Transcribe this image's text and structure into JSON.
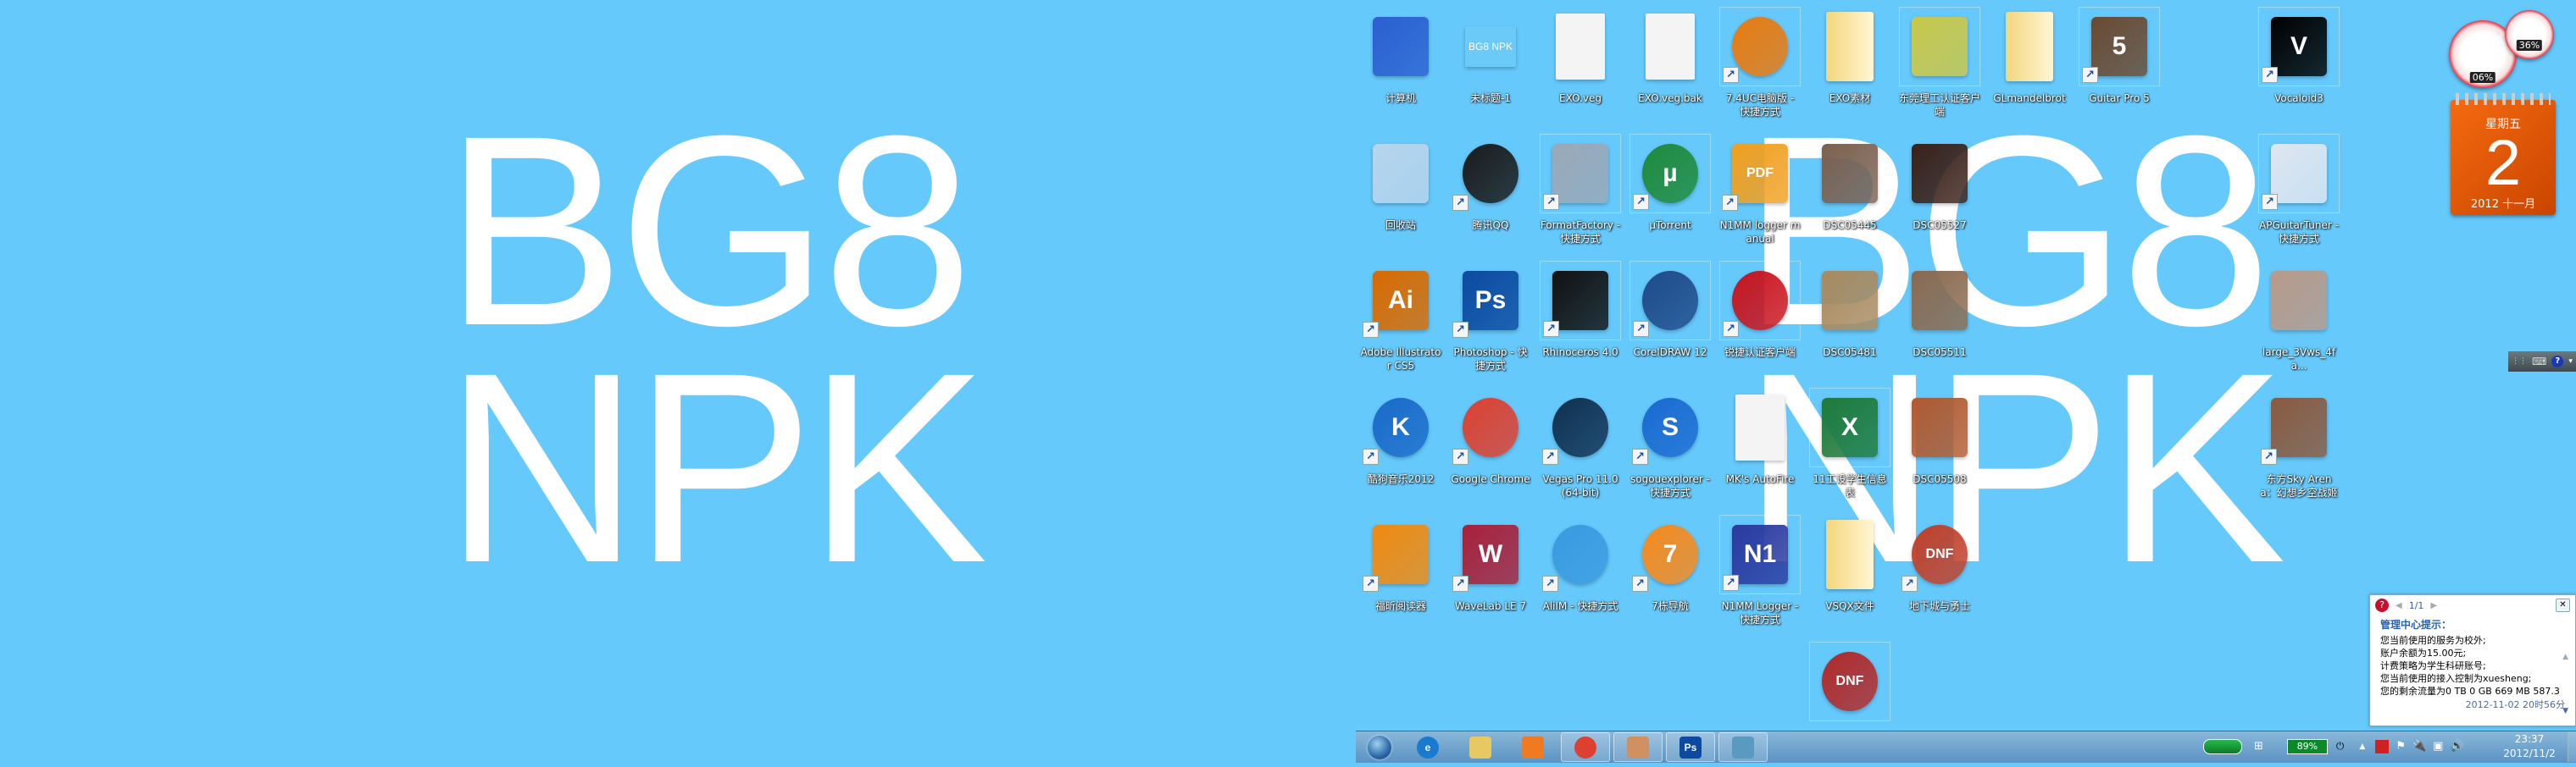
{
  "wallpaper": {
    "line1": "BG8",
    "line2": "NPK",
    "background": "#65c9fc"
  },
  "desktop_icons": [
    {
      "label": "计算机",
      "row": 0,
      "col": 0,
      "icon": "computer-icon",
      "color": "#2a5fd0",
      "shape": "square"
    },
    {
      "label": "未标题-1",
      "row": 0,
      "col": 1,
      "icon": "image-thumbnail-icon",
      "color": "#6ccaf7",
      "glyph": "BG8 NPK",
      "shape": "thumb"
    },
    {
      "label": "EXO.veg",
      "row": 0,
      "col": 2,
      "icon": "blank-file-icon",
      "color": "#f4f4f4",
      "shape": "doc"
    },
    {
      "label": "EXO.veg.bak",
      "row": 0,
      "col": 3,
      "icon": "blank-file-icon",
      "color": "#f4f4f4",
      "shape": "doc"
    },
    {
      "label": "7.4UC电脑版 - 快捷方式",
      "row": 0,
      "col": 4,
      "icon": "uc-browser-icon",
      "color": "#e87a10",
      "shape": "round",
      "shortcut": true,
      "framed": true
    },
    {
      "label": "EXO素材",
      "row": 0,
      "col": 5,
      "icon": "folder-icon",
      "color": "#f3d67c",
      "shape": "folder"
    },
    {
      "label": "东莞理工认证客户端",
      "row": 0,
      "col": 6,
      "icon": "installer-icon",
      "color": "#c8c84a",
      "shape": "square",
      "framed": true
    },
    {
      "label": "GLmandelbrot",
      "row": 0,
      "col": 7,
      "icon": "folder-icon",
      "color": "#f3d67c",
      "shape": "folder"
    },
    {
      "label": "Guitar Pro 5",
      "row": 0,
      "col": 8,
      "icon": "guitar-pro-icon",
      "color": "#6a4a32",
      "glyph": "5",
      "shape": "square",
      "shortcut": true,
      "framed": true
    },
    {
      "label": "Vocaloid3",
      "row": 0,
      "col": 10,
      "icon": "vocaloid-icon",
      "color": "#000000",
      "glyph": "V",
      "shape": "square",
      "shortcut": true,
      "framed": true
    },
    {
      "label": "回收站",
      "row": 1,
      "col": 0,
      "icon": "recycle-bin-icon",
      "color": "#b8d4ec",
      "shape": "square"
    },
    {
      "label": "腾讯QQ",
      "row": 1,
      "col": 1,
      "icon": "qq-penguin-icon",
      "color": "#1a1a1a",
      "shape": "round",
      "shortcut": true
    },
    {
      "label": "FormatFactory - 快捷方式",
      "row": 1,
      "col": 2,
      "icon": "format-factory-icon",
      "color": "#9aa8b8",
      "shape": "square",
      "shortcut": true,
      "framed": true
    },
    {
      "label": "µTorrent",
      "row": 1,
      "col": 3,
      "icon": "utorrent-icon",
      "color": "#1e8a3a",
      "glyph": "µ",
      "shape": "round",
      "shortcut": true,
      "framed": true
    },
    {
      "label": "N1MM logger manual",
      "row": 1,
      "col": 4,
      "icon": "pdf-file-icon",
      "color": "#f0a020",
      "glyph": "PDF",
      "shape": "square",
      "shortcut": true
    },
    {
      "label": "DSC05445",
      "row": 1,
      "col": 5,
      "icon": "photo-thumbnail-icon",
      "color": "#7a6050",
      "shape": "square"
    },
    {
      "label": "DSC05527",
      "row": 1,
      "col": 6,
      "icon": "photo-thumbnail-icon",
      "color": "#3a2018",
      "shape": "square"
    },
    {
      "label": "APGuitarTuner - 快捷方式",
      "row": 1,
      "col": 10,
      "icon": "guitar-tuner-icon",
      "color": "#dfe6f0",
      "shape": "square",
      "shortcut": true,
      "framed": true
    },
    {
      "label": "Adobe Illustrator CS5",
      "row": 2,
      "col": 0,
      "icon": "illustrator-icon",
      "color": "#d86a00",
      "glyph": "Ai",
      "shape": "square",
      "shortcut": true
    },
    {
      "label": "Photoshop - 快捷方式",
      "row": 2,
      "col": 1,
      "icon": "photoshop-icon",
      "color": "#0b4aa0",
      "glyph": "Ps",
      "shape": "square",
      "shortcut": true
    },
    {
      "label": "Rhinoceros 4.0",
      "row": 2,
      "col": 2,
      "icon": "rhinoceros-icon",
      "color": "#111111",
      "shape": "square",
      "shortcut": true,
      "framed": true
    },
    {
      "label": "CorelDRAW 12",
      "row": 2,
      "col": 3,
      "icon": "coreldraw-icon",
      "color": "#1f4a8a",
      "shape": "round",
      "shortcut": true,
      "framed": true
    },
    {
      "label": "锐捷认证客户端",
      "row": 2,
      "col": 4,
      "icon": "ruijie-client-icon",
      "color": "#c8141e",
      "shape": "round",
      "shortcut": true,
      "framed": true
    },
    {
      "label": "DSC05481",
      "row": 2,
      "col": 5,
      "icon": "photo-thumbnail-icon",
      "color": "#a88a60",
      "shape": "square"
    },
    {
      "label": "DSC05511",
      "row": 2,
      "col": 6,
      "icon": "photo-thumbnail-icon",
      "color": "#8a6a50",
      "shape": "square"
    },
    {
      "label": "large_3Vws_4fa...",
      "row": 2,
      "col": 10,
      "icon": "photo-thumbnail-icon",
      "color": "#b89a8a",
      "shape": "square"
    },
    {
      "label": "酷狗音乐2012",
      "row": 3,
      "col": 0,
      "icon": "kugou-icon",
      "color": "#1a6ac8",
      "glyph": "K",
      "shape": "round",
      "shortcut": true
    },
    {
      "label": "Google Chrome",
      "row": 3,
      "col": 1,
      "icon": "chrome-icon",
      "color": "#dd4030",
      "shape": "round",
      "shortcut": true
    },
    {
      "label": "Vegas Pro 11.0 (64-bit)",
      "row": 3,
      "col": 2,
      "icon": "vegas-pro-icon",
      "color": "#103050",
      "shape": "round",
      "shortcut": true
    },
    {
      "label": "sogouexplorer - 快捷方式",
      "row": 3,
      "col": 3,
      "icon": "sogou-explorer-icon",
      "color": "#1a6ad0",
      "glyph": "S",
      "shape": "round",
      "shortcut": true
    },
    {
      "label": "MK's AutoFire",
      "row": 3,
      "col": 4,
      "icon": "settings-file-icon",
      "color": "#e8eef6",
      "shape": "doc"
    },
    {
      "label": "11工设学生信息表",
      "row": 3,
      "col": 5,
      "icon": "excel-file-icon",
      "color": "#1e7a3a",
      "glyph": "X",
      "shape": "square",
      "framed": true
    },
    {
      "label": "DSC05508",
      "row": 3,
      "col": 6,
      "icon": "photo-thumbnail-icon",
      "color": "#b05a30",
      "shape": "square"
    },
    {
      "label": "东方Sky Arena：幻想乡空战姬",
      "row": 3,
      "col": 10,
      "icon": "touhou-game-icon",
      "color": "#8a5a40",
      "shape": "square",
      "shortcut": true
    },
    {
      "label": "福昕阅读器",
      "row": 4,
      "col": 0,
      "icon": "foxit-reader-icon",
      "color": "#f08a10",
      "shape": "square",
      "shortcut": true
    },
    {
      "label": "WaveLab LE 7",
      "row": 4,
      "col": 1,
      "icon": "wavelab-icon",
      "color": "#a8203a",
      "glyph": "W",
      "shape": "square",
      "shortcut": true
    },
    {
      "label": "AliIM - 快捷方式",
      "row": 4,
      "col": 2,
      "icon": "aliim-icon",
      "color": "#3a9ae0",
      "shape": "round",
      "shortcut": true
    },
    {
      "label": "7栋导航",
      "row": 4,
      "col": 3,
      "icon": "navigation-7-icon",
      "color": "#f58a1e",
      "glyph": "7",
      "shape": "round",
      "shortcut": true
    },
    {
      "label": "N1MM Logger - 快捷方式",
      "row": 4,
      "col": 4,
      "icon": "n1mm-icon",
      "color": "#2a3aa0",
      "glyph": "N1",
      "shape": "square",
      "shortcut": true,
      "framed": true
    },
    {
      "label": "VSQX文件",
      "row": 4,
      "col": 5,
      "icon": "folder-icon",
      "color": "#f3d67c",
      "shape": "folder"
    },
    {
      "label": "地下城与勇士",
      "row": 4,
      "col": 6,
      "icon": "dnf-game-icon",
      "color": "#c0402a",
      "glyph": "DNF",
      "shape": "round",
      "shortcut": true
    },
    {
      "label": "",
      "row": 5,
      "col": 5,
      "icon": "dnf-game-icon",
      "color": "#b02a2a",
      "glyph": "DNF",
      "shape": "round",
      "framed": true
    }
  ],
  "gadgets": {
    "cpu_meter": {
      "cpu": "06%",
      "memory": "36%"
    },
    "calendar": {
      "weekday": "星期五",
      "day": "2",
      "year_month": "2012 十一月"
    }
  },
  "notification": {
    "page": "1/1",
    "title": "管理中心提示：",
    "lines": [
      "您当前使用的服务为校外;",
      "账户余额为15.00元;",
      "计费策略为学生科研账号;",
      "您当前使用的接入控制为xuesheng;",
      "您的剩余流量为0 TB 0 GB 669 MB 587.3"
    ],
    "date": "2012-11-02 20时56分"
  },
  "taskbar": {
    "pinned": [
      {
        "icon": "internet-explorer-icon",
        "color": "#1a7ad0",
        "glyph": "e",
        "open": false
      },
      {
        "icon": "file-explorer-icon",
        "color": "#e8c860",
        "open": false
      },
      {
        "icon": "media-player-icon",
        "color": "#f07a20",
        "open": false
      },
      {
        "icon": "chrome-icon",
        "color": "#dd4030",
        "open": true
      },
      {
        "icon": "contacts-icon",
        "color": "#d09060",
        "open": true
      },
      {
        "icon": "photoshop-icon",
        "color": "#0b4aa0",
        "glyph": "Ps",
        "open": true
      },
      {
        "icon": "photo-viewer-icon",
        "color": "#5a9ac0",
        "open": true
      }
    ],
    "battery": "89%",
    "clock_time": "23:37",
    "clock_date": "2012/11/2"
  }
}
